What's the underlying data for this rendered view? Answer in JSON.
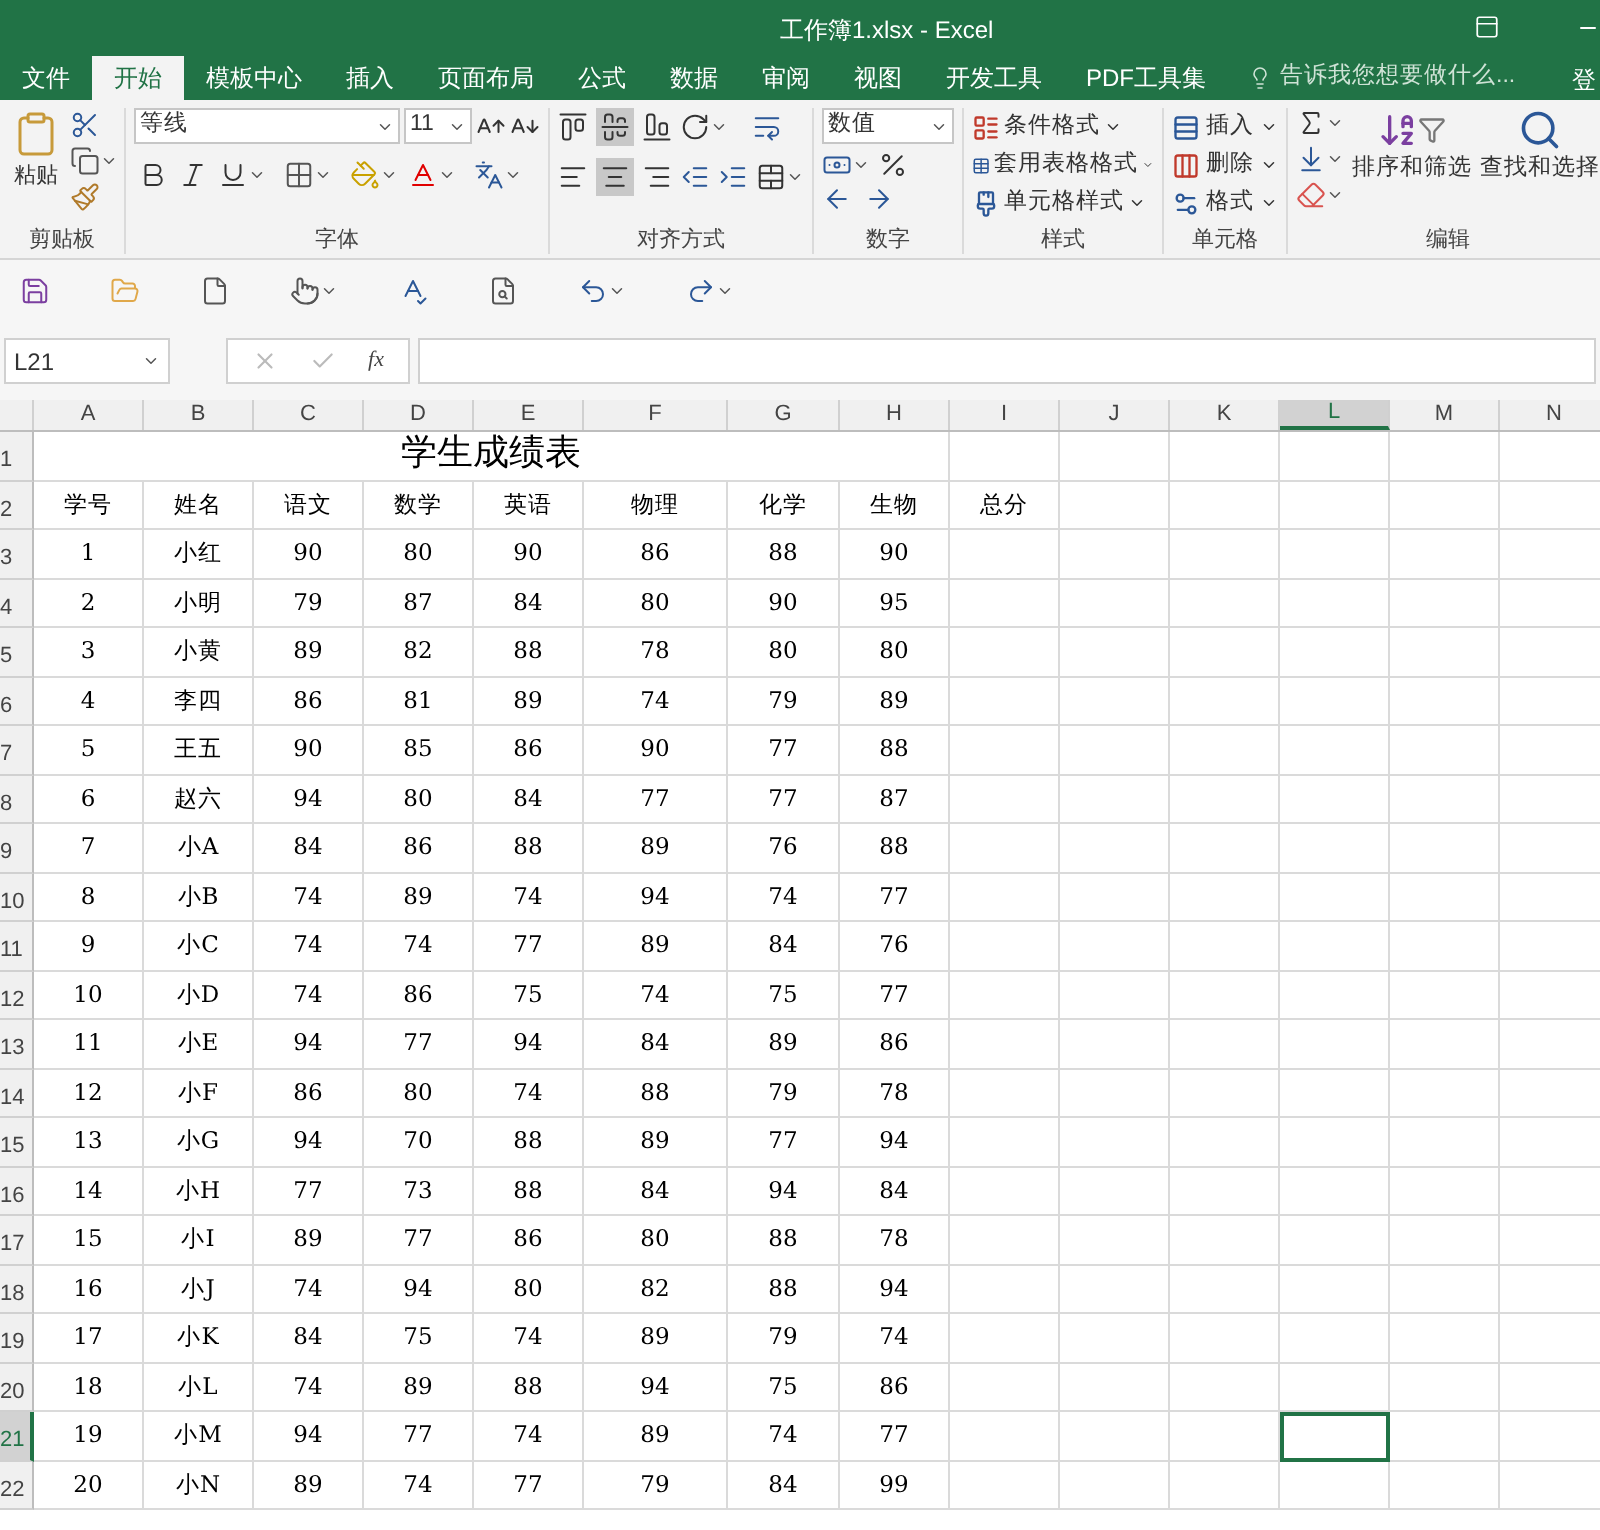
{
  "window": {
    "title": "工作簿1.xlsx - Excel"
  },
  "tabs": [
    {
      "label": "文件",
      "selected": false
    },
    {
      "label": "开始",
      "selected": true
    },
    {
      "label": "模板中心",
      "selected": false
    },
    {
      "label": "插入",
      "selected": false
    },
    {
      "label": "页面布局",
      "selected": false
    },
    {
      "label": "公式",
      "selected": false
    },
    {
      "label": "数据",
      "selected": false
    },
    {
      "label": "审阅",
      "selected": false
    },
    {
      "label": "视图",
      "selected": false
    },
    {
      "label": "开发工具",
      "selected": false
    },
    {
      "label": "PDF工具集",
      "selected": false
    }
  ],
  "tell_me": {
    "placeholder": "告诉我您想要做什么..."
  },
  "sign_in": "登",
  "ribbon": {
    "clipboard": {
      "label": "剪贴板",
      "paste": "粘贴"
    },
    "font": {
      "label": "字体",
      "font_name": "等线",
      "font_size": "11"
    },
    "alignment": {
      "label": "对齐方式"
    },
    "number": {
      "label": "数字",
      "format": "数值"
    },
    "styles": {
      "label": "样式",
      "items": [
        "条件格式",
        "套用表格格式",
        "单元格样式"
      ]
    },
    "cells": {
      "label": "单元格",
      "items": [
        "插入",
        "删除",
        "格式"
      ]
    },
    "editing": {
      "label": "编辑",
      "sort": "排序和筛选",
      "find": "查找和选择"
    }
  },
  "name_box": "L21",
  "fx": "fx",
  "sheet": {
    "columns": [
      {
        "label": "A",
        "selected": false
      },
      {
        "label": "B",
        "selected": false
      },
      {
        "label": "C",
        "selected": false
      },
      {
        "label": "D",
        "selected": false
      },
      {
        "label": "E",
        "selected": false
      },
      {
        "label": "F",
        "selected": false
      },
      {
        "label": "G",
        "selected": false
      },
      {
        "label": "H",
        "selected": false
      },
      {
        "label": "I",
        "selected": false
      },
      {
        "label": "J",
        "selected": false
      },
      {
        "label": "K",
        "selected": false
      },
      {
        "label": "L",
        "selected": true
      },
      {
        "label": "M",
        "selected": false
      },
      {
        "label": "N",
        "selected": false
      }
    ],
    "rows": [
      {
        "label": "1",
        "selected": false,
        "title": "学生成绩表"
      },
      {
        "label": "2",
        "selected": false,
        "cells": [
          "学号",
          "姓名",
          "语文",
          "数学",
          "英语",
          "物理",
          "化学",
          "生物",
          "总分"
        ]
      },
      {
        "label": "3",
        "selected": false,
        "cells": [
          "1",
          "小红",
          "90",
          "80",
          "90",
          "86",
          "88",
          "90"
        ]
      },
      {
        "label": "4",
        "selected": false,
        "cells": [
          "2",
          "小明",
          "79",
          "87",
          "84",
          "80",
          "90",
          "95"
        ]
      },
      {
        "label": "5",
        "selected": false,
        "cells": [
          "3",
          "小黄",
          "89",
          "82",
          "88",
          "78",
          "80",
          "80"
        ]
      },
      {
        "label": "6",
        "selected": false,
        "cells": [
          "4",
          "李四",
          "86",
          "81",
          "89",
          "74",
          "79",
          "89"
        ]
      },
      {
        "label": "7",
        "selected": false,
        "cells": [
          "5",
          "王五",
          "90",
          "85",
          "86",
          "90",
          "77",
          "88"
        ]
      },
      {
        "label": "8",
        "selected": false,
        "cells": [
          "6",
          "赵六",
          "94",
          "80",
          "84",
          "77",
          "77",
          "87"
        ]
      },
      {
        "label": "9",
        "selected": false,
        "cells": [
          "7",
          "小A",
          "84",
          "86",
          "88",
          "89",
          "76",
          "88"
        ]
      },
      {
        "label": "10",
        "selected": false,
        "cells": [
          "8",
          "小B",
          "74",
          "89",
          "74",
          "94",
          "74",
          "77"
        ]
      },
      {
        "label": "11",
        "selected": false,
        "cells": [
          "9",
          "小C",
          "74",
          "74",
          "77",
          "89",
          "84",
          "76"
        ]
      },
      {
        "label": "12",
        "selected": false,
        "cells": [
          "10",
          "小D",
          "74",
          "86",
          "75",
          "74",
          "75",
          "77"
        ]
      },
      {
        "label": "13",
        "selected": false,
        "cells": [
          "11",
          "小E",
          "94",
          "77",
          "94",
          "84",
          "89",
          "86"
        ]
      },
      {
        "label": "14",
        "selected": false,
        "cells": [
          "12",
          "小F",
          "86",
          "80",
          "74",
          "88",
          "79",
          "78"
        ]
      },
      {
        "label": "15",
        "selected": false,
        "cells": [
          "13",
          "小G",
          "94",
          "70",
          "88",
          "89",
          "77",
          "94"
        ]
      },
      {
        "label": "16",
        "selected": false,
        "cells": [
          "14",
          "小H",
          "77",
          "73",
          "88",
          "84",
          "94",
          "84"
        ]
      },
      {
        "label": "17",
        "selected": false,
        "cells": [
          "15",
          "小I",
          "89",
          "77",
          "86",
          "80",
          "88",
          "78"
        ]
      },
      {
        "label": "18",
        "selected": false,
        "cells": [
          "16",
          "小J",
          "74",
          "94",
          "80",
          "82",
          "88",
          "94"
        ]
      },
      {
        "label": "19",
        "selected": false,
        "cells": [
          "17",
          "小K",
          "84",
          "75",
          "74",
          "89",
          "79",
          "74"
        ]
      },
      {
        "label": "20",
        "selected": false,
        "cells": [
          "18",
          "小L",
          "74",
          "89",
          "88",
          "94",
          "75",
          "86"
        ]
      },
      {
        "label": "21",
        "selected": true,
        "cells": [
          "19",
          "小M",
          "94",
          "77",
          "74",
          "89",
          "74",
          "77"
        ]
      },
      {
        "label": "22",
        "selected": false,
        "cells": [
          "20",
          "小N",
          "89",
          "74",
          "77",
          "79",
          "84",
          "99"
        ]
      }
    ]
  }
}
